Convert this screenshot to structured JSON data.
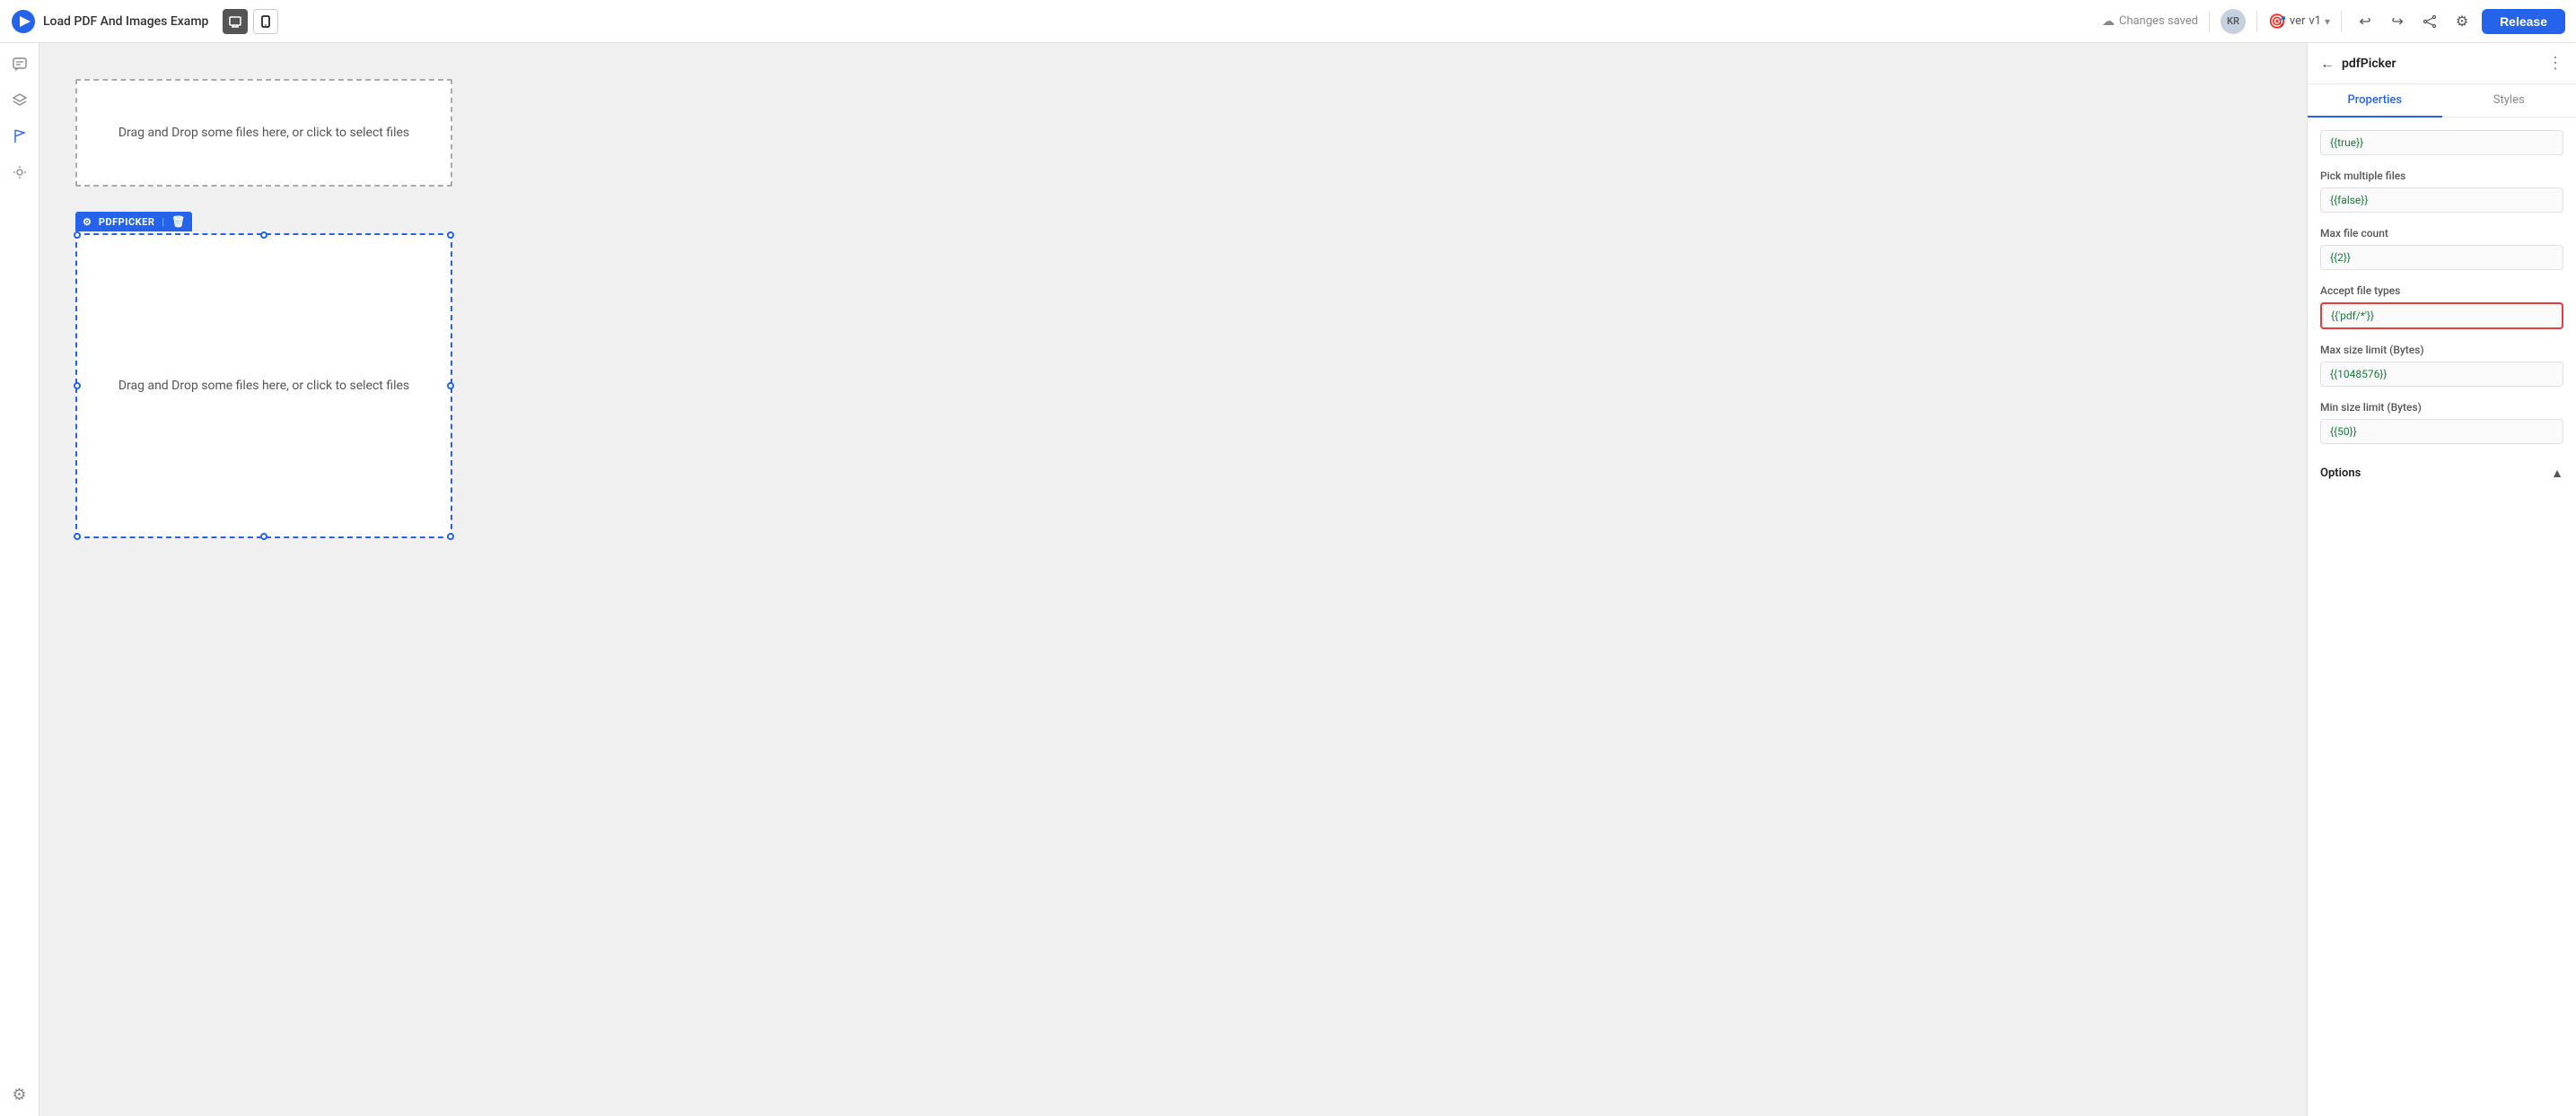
{
  "topbar": {
    "title": "Load PDF And Images Examp",
    "changes_saved": "Changes saved",
    "avatar_initials": "KR",
    "version_label": "ver",
    "version_number": "v1",
    "release_label": "Release"
  },
  "sidebar": {
    "icons": [
      "comments",
      "layers",
      "flag",
      "star",
      "settings"
    ]
  },
  "canvas": {
    "inactive_picker_text": "Drag and Drop some files here, or click to select files",
    "active_picker_text": "Drag and Drop some files here, or click to select files",
    "active_label": "PDFPICKER"
  },
  "panel": {
    "title": "pdfPicker",
    "back_label": "←",
    "more_label": "⋮",
    "tabs": [
      "Properties",
      "Styles"
    ],
    "active_tab": "Properties",
    "properties": {
      "enabled_label": "Pick multiple files",
      "enabled_value": "{{false}}",
      "max_count_label": "Max file count",
      "max_count_value": "{{2}}",
      "accept_types_label": "Accept file types",
      "accept_types_value": "{{'pdf/*'}}",
      "max_size_label": "Max size limit (Bytes)",
      "max_size_value": "{{1048576}}",
      "min_size_label": "Min size limit (Bytes)",
      "min_size_value": "{{50}}",
      "scrolled_value": "{{true}}",
      "options_label": "Options"
    }
  }
}
